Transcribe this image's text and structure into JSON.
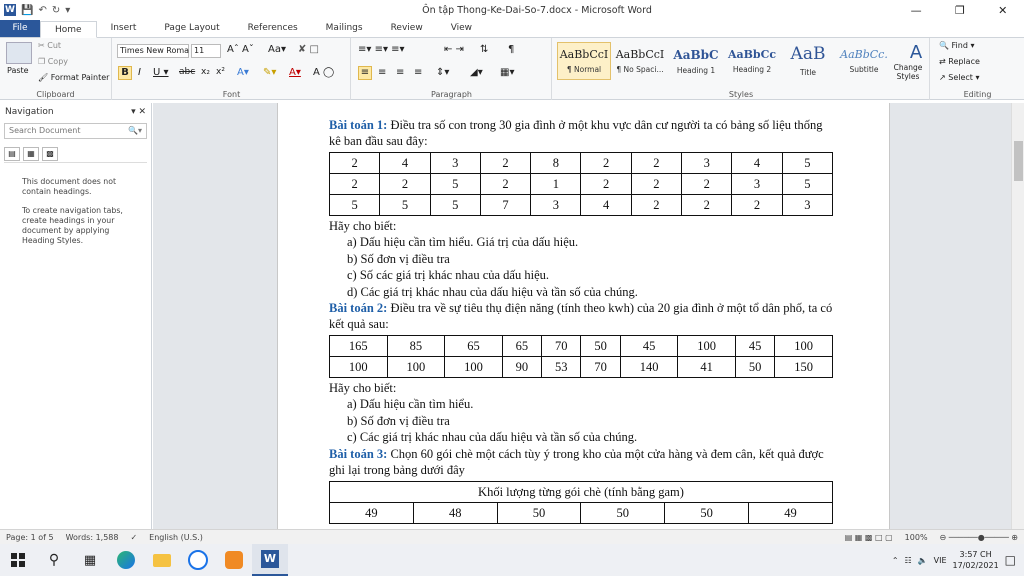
{
  "window": {
    "title": "Ôn tập Thong-Ke-Dai-So-7.docx  -  Microsoft Word"
  },
  "tabs": [
    "File",
    "Home",
    "Insert",
    "Page Layout",
    "References",
    "Mailings",
    "Review",
    "View"
  ],
  "ribbon": {
    "clipboard": {
      "label": "Clipboard",
      "paste": "Paste",
      "cut": "Cut",
      "copy": "Copy",
      "format_painter": "Format Painter"
    },
    "font": {
      "label": "Font",
      "family": "Times New Roma",
      "size": "11"
    },
    "paragraph": {
      "label": "Paragraph"
    },
    "styles": {
      "label": "Styles",
      "items": [
        {
          "preview": "AaBbCcI",
          "name": "¶ Normal"
        },
        {
          "preview": "AaBbCcI",
          "name": "¶ No Spaci..."
        },
        {
          "preview": "AaBbC",
          "name": "Heading 1"
        },
        {
          "preview": "AaBbCc",
          "name": "Heading 2"
        },
        {
          "preview": "AaB",
          "name": "Title"
        },
        {
          "preview": "AaBbCc.",
          "name": "Subtitle"
        }
      ],
      "change_styles": "Change Styles"
    },
    "editing": {
      "label": "Editing",
      "find": "Find",
      "replace": "Replace",
      "select": "Select"
    }
  },
  "navigation": {
    "title": "Navigation",
    "search_placeholder": "Search Document",
    "msg1": "This document does not contain headings.",
    "msg2": "To create navigation tabs, create headings in your document by applying Heading Styles."
  },
  "document": {
    "p1_title": "Bài toán 1:",
    "p1_text": " Điều tra số con trong 30 gia đình ở một khu vực dân cư người ta có bảng số liệu thống kê ban đầu sau đây:",
    "table1": [
      [
        "2",
        "4",
        "3",
        "2",
        "8",
        "2",
        "2",
        "3",
        "4",
        "5"
      ],
      [
        "2",
        "2",
        "5",
        "2",
        "1",
        "2",
        "2",
        "2",
        "3",
        "5"
      ],
      [
        "5",
        "5",
        "5",
        "7",
        "3",
        "4",
        "2",
        "2",
        "2",
        "3"
      ]
    ],
    "p1_ask": "Hãy cho biết:",
    "p1_list": [
      "a)  Dấu hiệu cần tìm hiểu. Giá trị của dấu hiệu.",
      "b)  Số đơn vị điều tra",
      "c)  Số các giá trị khác nhau của dấu hiệu.",
      "d)  Các giá trị khác nhau của dấu hiệu và tần số của chúng."
    ],
    "p2_title": "Bài toán 2:",
    "p2_text": " Điều tra về sự tiêu thụ điện năng (tính theo kwh) của 20 gia đình ở một tổ dân phố, ta có kết quả sau:",
    "table2": [
      [
        "165",
        "85",
        "65",
        "65",
        "70",
        "50",
        "45",
        "100",
        "45",
        "100"
      ],
      [
        "100",
        "100",
        "100",
        "90",
        "53",
        "70",
        "140",
        "41",
        "50",
        "150"
      ]
    ],
    "p2_ask": "Hãy cho biết:",
    "p2_list": [
      "a)  Dấu hiệu cần tìm hiểu.",
      "b)  Số đơn vị điều tra",
      "c)  Các giá trị khác nhau của dấu hiệu và tần số của chúng."
    ],
    "p3_title": "Bài toán 3:",
    "p3_text": " Chọn 60 gói chè một cách tùy ý trong kho của một cửa hàng và đem cân, kết quả được ghi lại trong bảng dưới đây",
    "table3_header": "Khối lượng từng gói chè (tính bằng gam)",
    "table3_row": [
      "49",
      "48",
      "50",
      "50",
      "50",
      "49"
    ]
  },
  "status": {
    "page": "Page: 1 of 5",
    "words": "Words: 1,588",
    "lang": "English (U.S.)",
    "zoom": "100%"
  },
  "taskbar": {
    "lang": "VIE",
    "time": "3:57 CH",
    "date": "17/02/2021"
  }
}
